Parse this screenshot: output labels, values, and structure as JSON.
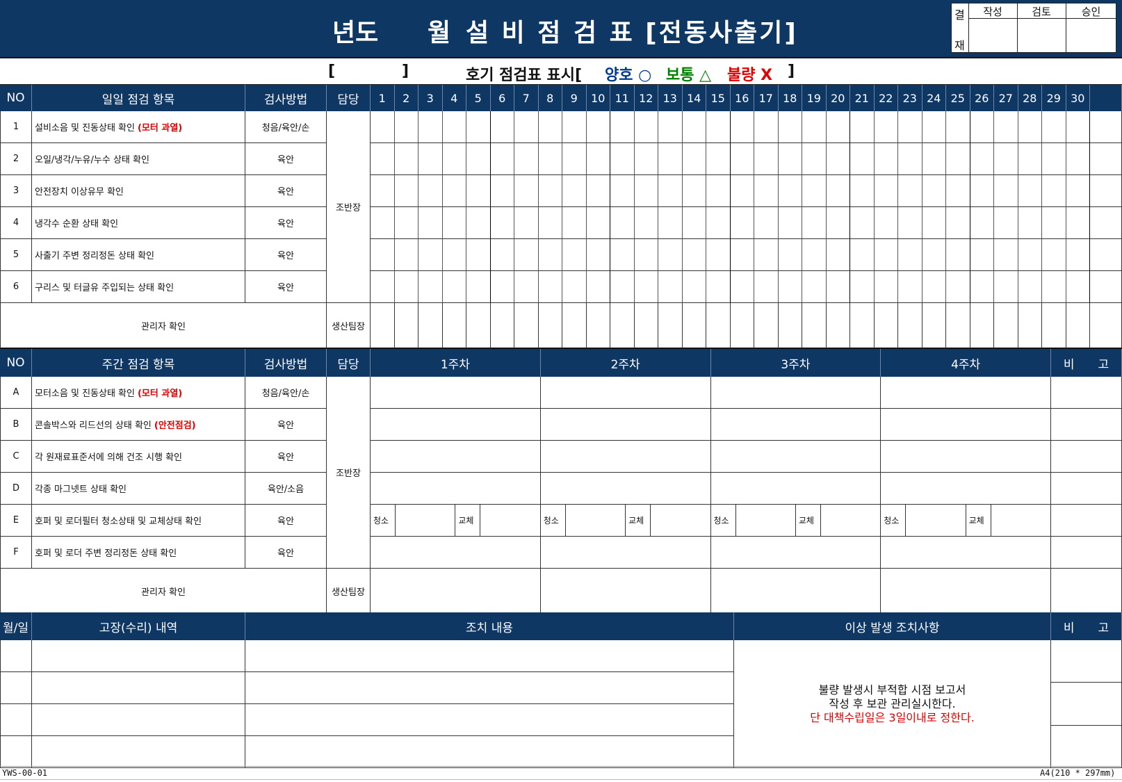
{
  "title": {
    "year": "년도",
    "month": "월",
    "rest": "설 비 점 검 표 [전동사출기]"
  },
  "approval": {
    "side_top": "결",
    "side_bottom": "재",
    "cols": [
      "작성",
      "검토",
      "승인"
    ]
  },
  "legend": {
    "bracket_open": "[",
    "bracket_close": "]",
    "prefix": "호기 점검표 표시[",
    "good": "양호 ○",
    "normal": "보통 △",
    "bad": "불량 X",
    "suffix": "]",
    "colors": {
      "good": "#003a8c",
      "normal": "#008000",
      "bad": "#e00000"
    }
  },
  "daily": {
    "headers": {
      "no": "NO",
      "item": "일일 점검 항목",
      "method": "검사방법",
      "owner": "담당"
    },
    "days": [
      "1",
      "2",
      "3",
      "4",
      "5",
      "6",
      "7",
      "8",
      "9",
      "10",
      "11",
      "12",
      "13",
      "14",
      "15",
      "16",
      "17",
      "18",
      "19",
      "20",
      "21",
      "22",
      "23",
      "24",
      "25",
      "26",
      "27",
      "28",
      "29",
      "30"
    ],
    "rows": [
      {
        "no": "1",
        "item": "설비소음 및 진동상태 확인",
        "note": "(모터 과열)",
        "method": "청음/육안/손"
      },
      {
        "no": "2",
        "item": "오일/냉각/누유/누수 상태 확인",
        "note": "",
        "method": "육안"
      },
      {
        "no": "3",
        "item": "안전장치 이상유무 확인",
        "note": "",
        "method": "육안"
      },
      {
        "no": "4",
        "item": "냉각수 순환 상태 확인",
        "note": "",
        "method": "육안"
      },
      {
        "no": "5",
        "item": "사출기 주변 정리정돈 상태 확인",
        "note": "",
        "method": "육안"
      },
      {
        "no": "6",
        "item": "구리스 및 터글유 주입되는 상태 확인",
        "note": "",
        "method": "육안"
      }
    ],
    "owner": "조반장",
    "manager_label": "관리자 확인",
    "manager_owner": "생산팀장"
  },
  "weekly": {
    "headers": {
      "no": "NO",
      "item": "주간 점검 항목",
      "method": "검사방법",
      "owner": "담당",
      "remark": "비　　고"
    },
    "weeks": [
      "1주차",
      "2주차",
      "3주차",
      "4주차"
    ],
    "rows": [
      {
        "no": "A",
        "item": "모터소음 및 진동상태 확인",
        "note": "(모터 과열)",
        "method": "청음/육안/손"
      },
      {
        "no": "B",
        "item": "콘솔박스와 리드선의 상태 확인",
        "note": "(안전점검)",
        "method": "육안"
      },
      {
        "no": "C",
        "item": "각 원재료표준서에 의해 건조 시행 확인",
        "note": "",
        "method": "육안"
      },
      {
        "no": "D",
        "item": "각종 마그넷트 상태 확인",
        "note": "",
        "method": "육안/소음"
      },
      {
        "no": "E",
        "item": "호퍼 및 로더필터 청소상태 및 교체상태 확인",
        "note": "",
        "method": "육안"
      },
      {
        "no": "F",
        "item": "호퍼 및 로더 주변 정리정돈 상태 확인",
        "note": "",
        "method": "육안"
      }
    ],
    "clean_label": "청소",
    "replace_label": "교체",
    "owner": "조반장",
    "manager_label": "관리자 확인",
    "manager_owner": "생산팀장"
  },
  "repair": {
    "headers": {
      "date": "월/일",
      "detail": "고장(수리) 내역",
      "action": "조치 내용",
      "abnormal": "이상 발생 조치사항",
      "remark": "비　　고"
    },
    "note_line1": "불량 발생시 부적합 시점 보고서",
    "note_line2": "작성 후 보관 관리실시한다.",
    "note_line3": "단 대책수립일은 3일이내로 정한다."
  },
  "footer": {
    "code": "YWS-00-01",
    "paper": "A4(210 * 297mm)"
  }
}
